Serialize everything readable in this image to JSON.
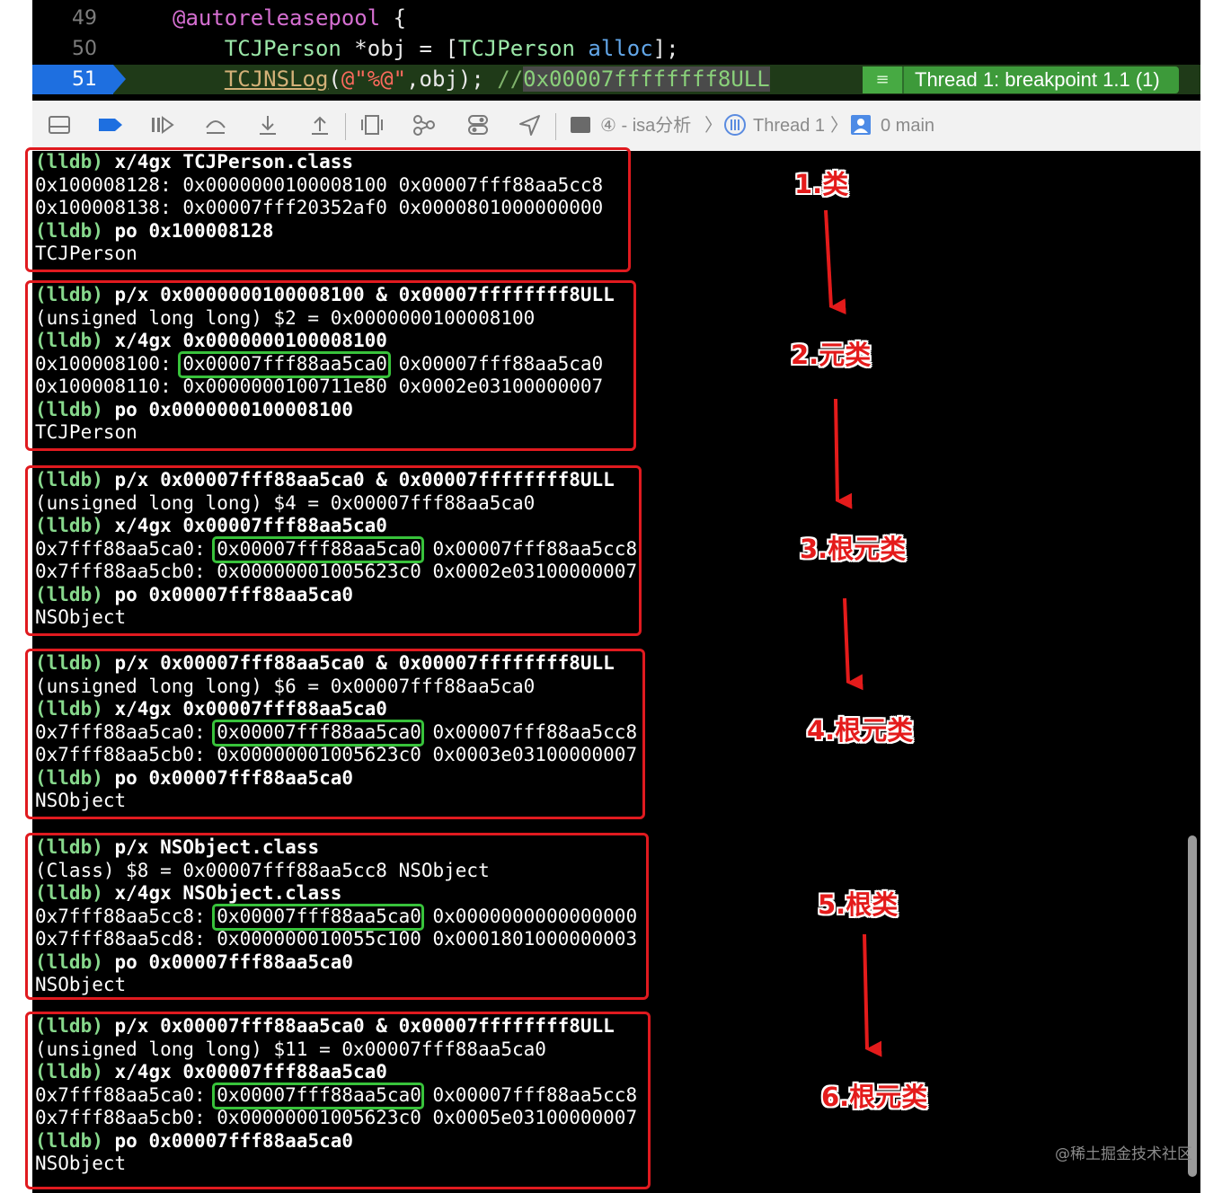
{
  "editor": {
    "lines": [
      {
        "num": "49",
        "parts": [
          [
            "kw-at",
            "@autoreleasepool"
          ],
          [
            "",
            " {"
          ]
        ]
      },
      {
        "num": "50",
        "parts": [
          [
            "",
            "    "
          ],
          [
            "cls",
            "TCJPerson"
          ],
          [
            "",
            " *obj = ["
          ],
          [
            "cls",
            "TCJPerson"
          ],
          [
            "",
            " "
          ],
          [
            "method",
            "alloc"
          ],
          [
            "",
            "];"
          ]
        ]
      },
      {
        "num": "51",
        "parts": [
          [
            "",
            "    "
          ],
          [
            "func",
            "TCJNSLog"
          ],
          [
            "",
            "("
          ],
          [
            "str",
            "@\"%@\""
          ],
          [
            "",
            ",obj); "
          ],
          [
            "cmt",
            "//"
          ],
          [
            "cmt-hl",
            "0x00007ffffffff8ULL"
          ]
        ]
      }
    ],
    "thread_badge": "Thread 1: breakpoint 1.1 (1)",
    "thread_badge_icon": "≡"
  },
  "debug_bar": {
    "crumb_project": "④ - isa分析",
    "crumb_thread": "Thread 1",
    "crumb_frame": "0 main",
    "chevron": "〉"
  },
  "console": {
    "blocks": [
      {
        "lines": [
          {
            "prompt": "(lldb) ",
            "text": "x/4gx TCJPerson.class"
          },
          {
            "text": "0x100008128: 0x0000000100008100 0x00007fff88aa5cc8"
          },
          {
            "text": "0x100008138: 0x00007fff20352af0 0x0000801000000000"
          },
          {
            "prompt": "(lldb) ",
            "text": "po 0x100008128"
          },
          {
            "text": "TCJPerson"
          }
        ]
      },
      {
        "lines": [
          {
            "prompt": "(lldb) ",
            "text": "p/x 0x0000000100008100 & 0x00007ffffffff8ULL"
          },
          {
            "text": "(unsigned long long) $2 = 0x0000000100008100"
          },
          {
            "prompt": "(lldb) ",
            "text": "x/4gx 0x0000000100008100"
          },
          {
            "text": "0x100008100: 0x00007fff88aa5ca0 0x00007fff88aa5ca0"
          },
          {
            "text": "0x100008110: 0x0000000100711e80 0x0002e03100000007"
          },
          {
            "prompt": "(lldb) ",
            "text": "po 0x0000000100008100"
          },
          {
            "text": "TCJPerson"
          }
        ]
      },
      {
        "lines": [
          {
            "prompt": "(lldb) ",
            "text": "p/x 0x00007fff88aa5ca0 & 0x00007ffffffff8ULL"
          },
          {
            "text": "(unsigned long long) $4 = 0x00007fff88aa5ca0"
          },
          {
            "prompt": "(lldb) ",
            "text": "x/4gx 0x00007fff88aa5ca0"
          },
          {
            "text": "0x7fff88aa5ca0: 0x00007fff88aa5ca0 0x00007fff88aa5cc8"
          },
          {
            "text": "0x7fff88aa5cb0: 0x00000001005623c0 0x0002e03100000007"
          },
          {
            "prompt": "(lldb) ",
            "text": "po 0x00007fff88aa5ca0"
          },
          {
            "text": "NSObject"
          }
        ]
      },
      {
        "lines": [
          {
            "prompt": "(lldb) ",
            "text": "p/x 0x00007fff88aa5ca0 & 0x00007ffffffff8ULL"
          },
          {
            "text": "(unsigned long long) $6 = 0x00007fff88aa5ca0"
          },
          {
            "prompt": "(lldb) ",
            "text": "x/4gx 0x00007fff88aa5ca0"
          },
          {
            "text": "0x7fff88aa5ca0: 0x00007fff88aa5ca0 0x00007fff88aa5cc8"
          },
          {
            "text": "0x7fff88aa5cb0: 0x00000001005623c0 0x0003e03100000007"
          },
          {
            "prompt": "(lldb) ",
            "text": "po 0x00007fff88aa5ca0"
          },
          {
            "text": "NSObject"
          }
        ]
      },
      {
        "lines": [
          {
            "prompt": "(lldb) ",
            "text": "p/x NSObject.class"
          },
          {
            "text": "(Class) $8 = 0x00007fff88aa5cc8 NSObject"
          },
          {
            "prompt": "(lldb) ",
            "text": "x/4gx NSObject.class"
          },
          {
            "text": "0x7fff88aa5cc8: 0x00007fff88aa5ca0 0x0000000000000000"
          },
          {
            "text": "0x7fff88aa5cd8: 0x000000010055c100 0x0001801000000003"
          },
          {
            "prompt": "(lldb) ",
            "text": "po 0x00007fff88aa5ca0"
          },
          {
            "text": "NSObject"
          }
        ]
      },
      {
        "lines": [
          {
            "prompt": "(lldb) ",
            "text": "p/x 0x00007fff88aa5ca0 & 0x00007ffffffff8ULL"
          },
          {
            "text": "(unsigned long long) $11 = 0x00007fff88aa5ca0"
          },
          {
            "prompt": "(lldb) ",
            "text": "x/4gx 0x00007fff88aa5ca0"
          },
          {
            "text": "0x7fff88aa5ca0: 0x00007fff88aa5ca0 0x00007fff88aa5cc8"
          },
          {
            "text": "0x7fff88aa5cb0: 0x00000001005623c0 0x0005e03100000007"
          },
          {
            "prompt": "(lldb) ",
            "text": "po 0x00007fff88aa5ca0"
          },
          {
            "text": "NSObject"
          }
        ]
      }
    ]
  },
  "annotations": [
    "1.类",
    "2.元类",
    "3.根元类",
    "4.根元类",
    "5.根类",
    "6.根元类"
  ],
  "colors": {
    "block_border": "#e01a1f",
    "highlight_border": "#38c23b",
    "prompt": "#87d88c",
    "annotation": "#e41b1b"
  },
  "watermark": "@稀土掘金技术社区"
}
